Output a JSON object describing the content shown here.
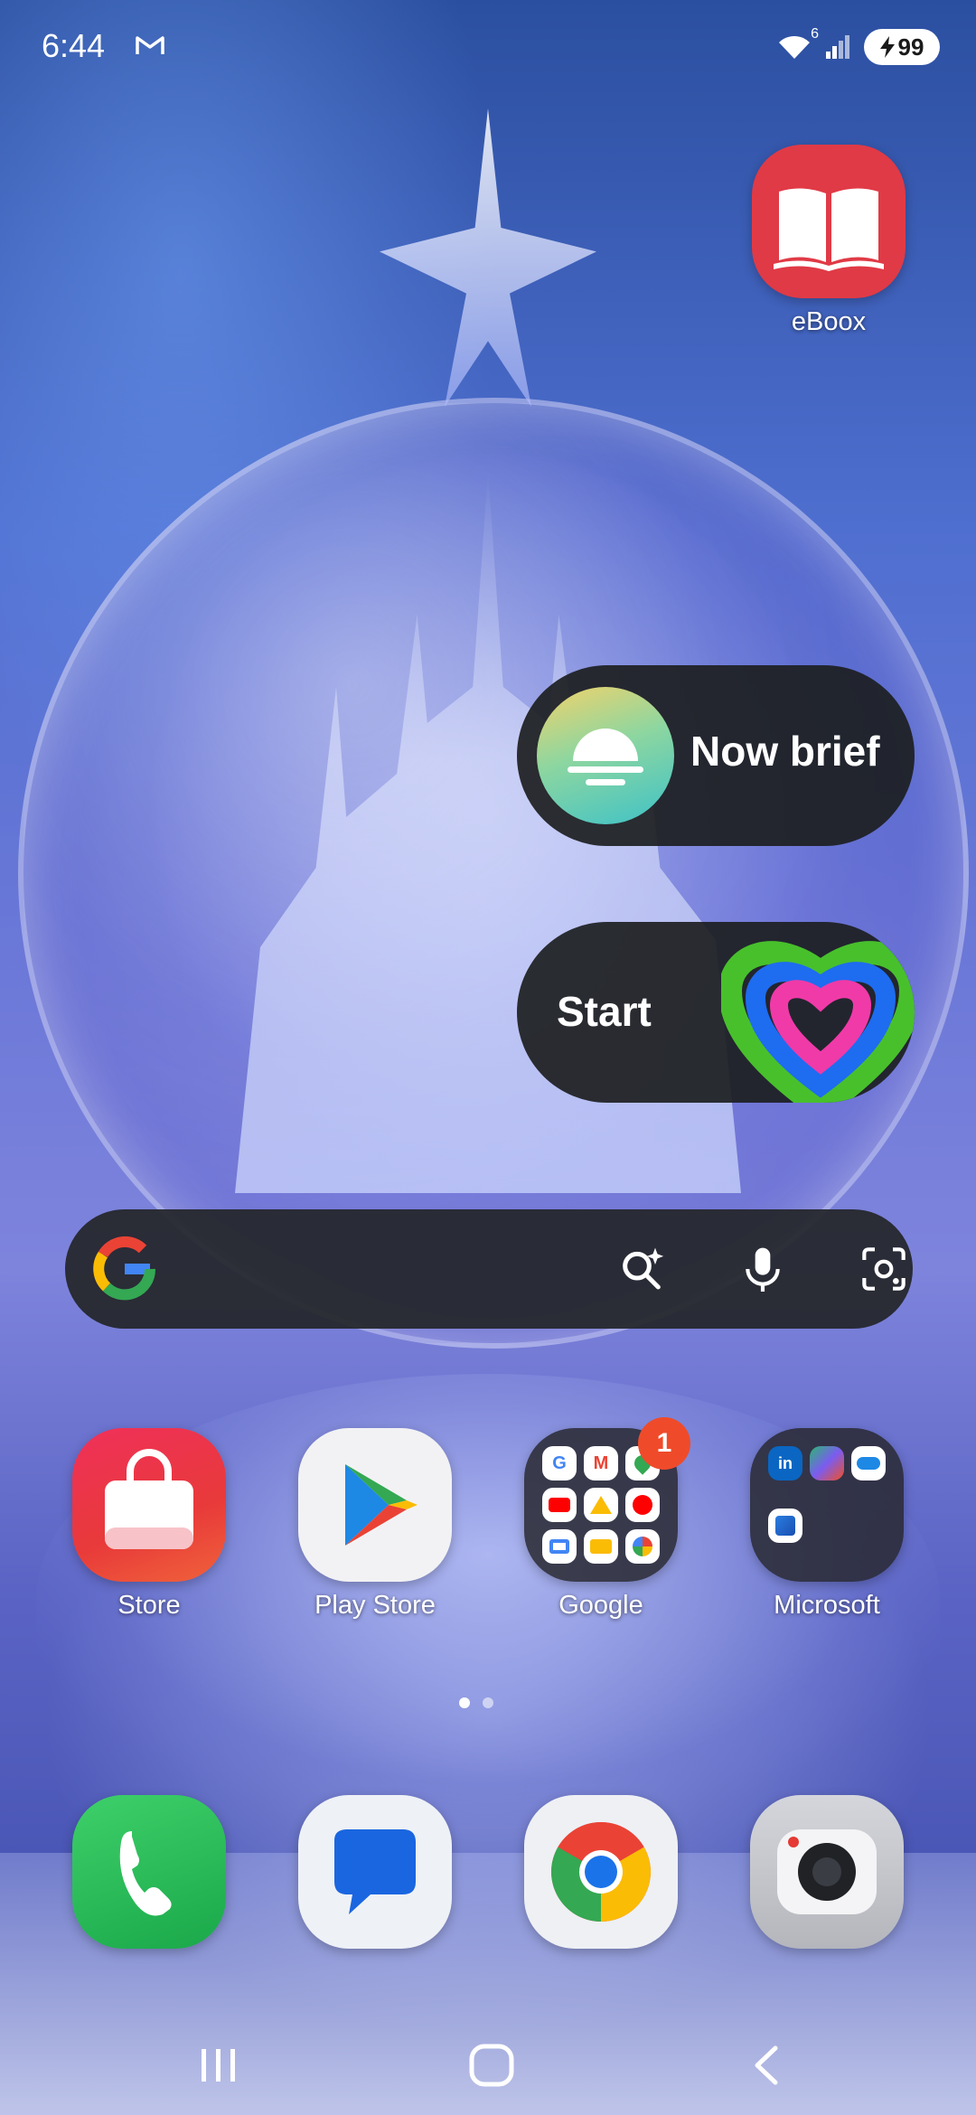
{
  "status_bar": {
    "time": "6:44",
    "notification_icon": "gmail-icon",
    "wifi_superscript": "6",
    "battery_level": "99",
    "battery_icon": "charging-bolt-icon"
  },
  "wallpaper": "crystal-castle-snow-globe",
  "top_apps": [
    {
      "label": "eBoox",
      "icon": "open-book-icon",
      "color": "#e03a46"
    }
  ],
  "widgets": {
    "now_brief": {
      "label": "Now brief",
      "icon": "now-brief-orb-icon"
    },
    "start": {
      "label": "Start",
      "icon": "health-heart-icon"
    }
  },
  "search_bar": {
    "logo": "google-g-icon",
    "buttons": [
      "ai-search-icon",
      "microphone-icon",
      "lens-camera-icon"
    ]
  },
  "dock_row_1": [
    {
      "label": "Store",
      "icon": "shopping-bag-icon"
    },
    {
      "label": "Play Store",
      "icon": "play-store-icon"
    },
    {
      "label": "Google",
      "icon": "folder-icon",
      "badge": "1"
    },
    {
      "label": "Microsoft",
      "icon": "folder-icon"
    }
  ],
  "dock_row_2": [
    {
      "label": "",
      "icon": "phone-icon"
    },
    {
      "label": "",
      "icon": "messages-icon"
    },
    {
      "label": "",
      "icon": "chrome-icon"
    },
    {
      "label": "",
      "icon": "camera-icon"
    }
  ],
  "pages": {
    "count": 2,
    "current": 1
  },
  "nav_bar": {
    "buttons": [
      "recents-icon",
      "home-icon",
      "back-icon"
    ]
  }
}
